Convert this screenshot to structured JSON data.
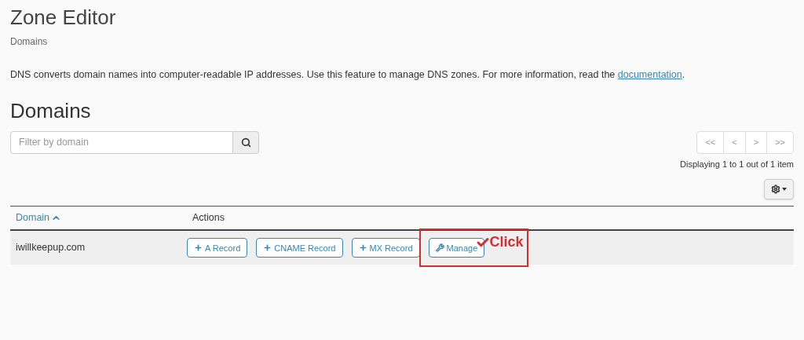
{
  "page": {
    "title": "Zone Editor",
    "breadcrumb": "Domains",
    "description": "DNS converts domain names into computer-readable IP addresses. Use this feature to manage DNS zones. For more information, read the ",
    "description_link": "documentation",
    "description_end": "."
  },
  "section": {
    "title": "Domains"
  },
  "search": {
    "placeholder": "Filter by domain"
  },
  "pagination": {
    "buttons": [
      "<<",
      "<",
      ">",
      ">>"
    ],
    "summary": "Displaying 1 to 1 out of 1 item"
  },
  "table": {
    "columns": [
      {
        "label": "Domain",
        "sorted": true
      },
      {
        "label": "Actions",
        "sorted": false
      }
    ],
    "rows": [
      {
        "domain": "iwillkeepup.com",
        "actions": [
          {
            "kind": "plus",
            "label": "A Record",
            "highlighted": false
          },
          {
            "kind": "plus",
            "label": "CNAME Record",
            "highlighted": false
          },
          {
            "kind": "plus",
            "label": "MX Record",
            "highlighted": false
          },
          {
            "kind": "wrench",
            "label": "Manage",
            "highlighted": true
          }
        ]
      }
    ]
  },
  "annotation": {
    "text": "Click"
  }
}
